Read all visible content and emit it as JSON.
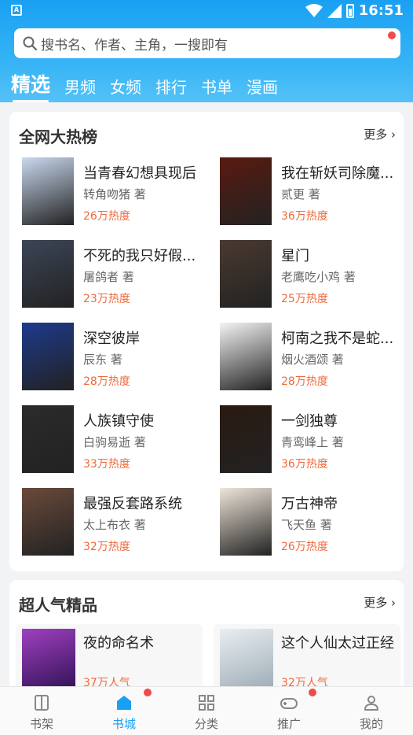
{
  "status": {
    "time": "16:51",
    "app_badge": "A"
  },
  "search": {
    "placeholder": "搜书名、作者、主角，一搜即有"
  },
  "tabs": [
    "精选",
    "男频",
    "女频",
    "排行",
    "书单",
    "漫画"
  ],
  "hot": {
    "title": "全网大热榜",
    "more": "更多",
    "books": [
      {
        "title": "当青春幻想具现后",
        "author": "转角吻猪 著",
        "heat": "26万热度",
        "cover": "#c9d9ee"
      },
      {
        "title": "我在斩妖司除魔...",
        "author": "贰更 著",
        "heat": "36万热度",
        "cover": "#5a1a10"
      },
      {
        "title": "不死的我只好假...",
        "author": "屠鸽者 著",
        "heat": "23万热度",
        "cover": "#3c4556"
      },
      {
        "title": "星门",
        "author": "老鹰吃小鸡 著",
        "heat": "25万热度",
        "cover": "#4a3a30"
      },
      {
        "title": "深空彼岸",
        "author": "辰东 著",
        "heat": "28万热度",
        "cover": "#1d3a8c"
      },
      {
        "title": "柯南之我不是蛇...",
        "author": "烟火酒颂 著",
        "heat": "28万热度",
        "cover": "#f4f4f4"
      },
      {
        "title": "人族镇守使",
        "author": "白驹易逝 著",
        "heat": "33万热度",
        "cover": "#2b2b2b"
      },
      {
        "title": "一剑独尊",
        "author": "青鸾峰上 著",
        "heat": "36万热度",
        "cover": "#2a1a12"
      },
      {
        "title": "最强反套路系统",
        "author": "太上布衣 著",
        "heat": "32万热度",
        "cover": "#6a4a3a"
      },
      {
        "title": "万古神帝",
        "author": "飞天鱼 著",
        "heat": "26万热度",
        "cover": "#efe6da"
      }
    ]
  },
  "picks": {
    "title": "超人气精品",
    "more": "更多",
    "books": [
      {
        "title": "夜的命名术",
        "heat": "37万人气",
        "cover": "#5b2a7a"
      },
      {
        "title": "这个人仙太过正经",
        "heat": "32万人气",
        "cover": "#dfe6ea"
      }
    ]
  },
  "nav": [
    {
      "label": "书架",
      "icon": "bookshelf-icon"
    },
    {
      "label": "书城",
      "icon": "store-icon"
    },
    {
      "label": "分类",
      "icon": "category-icon"
    },
    {
      "label": "推广",
      "icon": "gamepad-icon"
    },
    {
      "label": "我的",
      "icon": "user-icon"
    }
  ]
}
